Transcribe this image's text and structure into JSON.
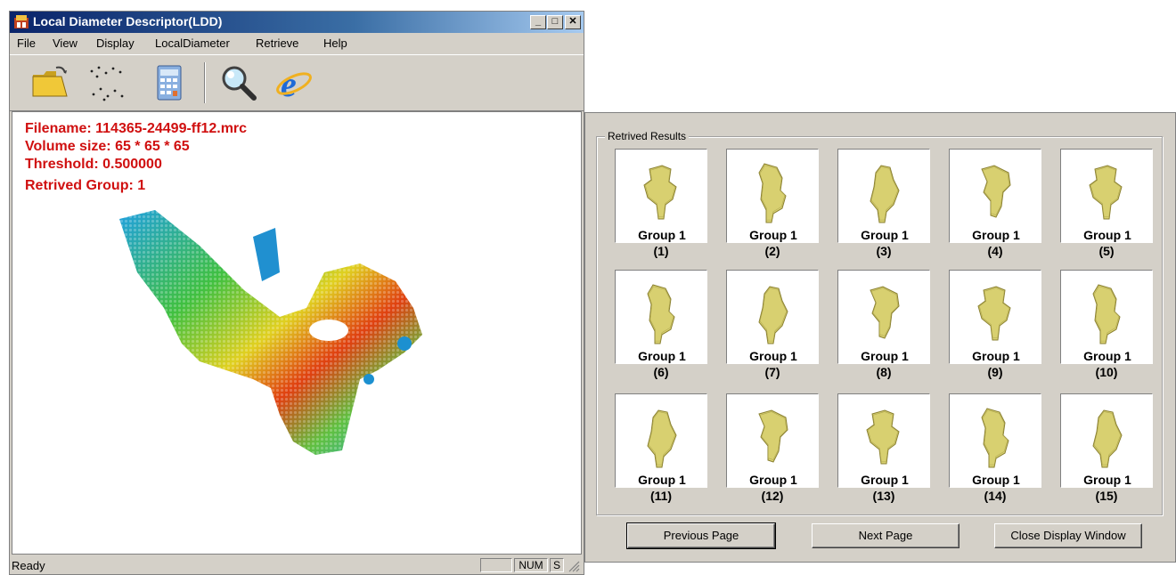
{
  "window": {
    "title": "Local Diameter Descriptor(LDD)",
    "menu": [
      "File",
      "View",
      "Display",
      "LocalDiameter",
      "Retrieve",
      "Help"
    ],
    "toolbar": [
      "open-folder-icon",
      "point-cloud-icon",
      "calculator-icon",
      "magnifier-icon",
      "internet-explorer-icon"
    ]
  },
  "info": {
    "filename": "Filename: 114365-24499-ff12.mrc",
    "volume_size": "Volume size: 65 * 65 * 65",
    "threshold": "Threshold: 0.500000",
    "retrieved_group": "Retrived Group: 1"
  },
  "status": {
    "ready": "Ready",
    "num": "NUM",
    "scrl": "S"
  },
  "results": {
    "group_label": "Retrived Results",
    "items": [
      {
        "group": "Group 1",
        "index": "(1)"
      },
      {
        "group": "Group 1",
        "index": "(2)"
      },
      {
        "group": "Group 1",
        "index": "(3)"
      },
      {
        "group": "Group 1",
        "index": "(4)"
      },
      {
        "group": "Group 1",
        "index": "(5)"
      },
      {
        "group": "Group 1",
        "index": "(6)"
      },
      {
        "group": "Group 1",
        "index": "(7)"
      },
      {
        "group": "Group 1",
        "index": "(8)"
      },
      {
        "group": "Group 1",
        "index": "(9)"
      },
      {
        "group": "Group 1",
        "index": "(10)"
      },
      {
        "group": "Group 1",
        "index": "(11)"
      },
      {
        "group": "Group 1",
        "index": "(12)"
      },
      {
        "group": "Group 1",
        "index": "(13)"
      },
      {
        "group": "Group 1",
        "index": "(14)"
      },
      {
        "group": "Group 1",
        "index": "(15)"
      }
    ],
    "buttons": {
      "previous": "Previous Page",
      "next": "Next Page",
      "close": "Close Display Window"
    }
  }
}
